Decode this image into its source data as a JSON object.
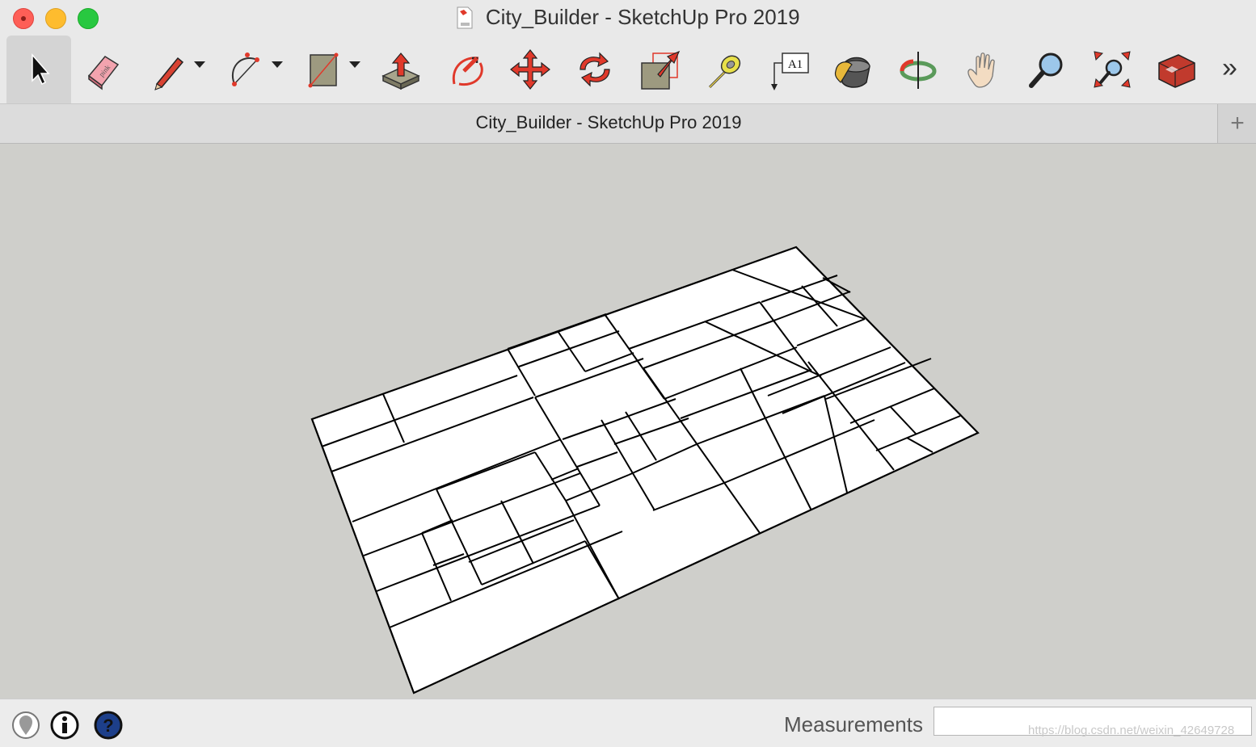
{
  "window": {
    "title": "City_Builder - SketchUp Pro 2019"
  },
  "toolbar": {
    "tools": [
      {
        "name": "select-tool",
        "label": "Select",
        "active": true
      },
      {
        "name": "eraser-tool",
        "label": "Eraser"
      },
      {
        "name": "pencil-tool",
        "label": "Line",
        "dropdown": true
      },
      {
        "name": "arc-tool",
        "label": "Arc",
        "dropdown": true
      },
      {
        "name": "rectangle-tool",
        "label": "Rectangle",
        "dropdown": true
      },
      {
        "name": "push-pull-tool",
        "label": "Push/Pull"
      },
      {
        "name": "offset-tool",
        "label": "Follow Me"
      },
      {
        "name": "move-tool",
        "label": "Move"
      },
      {
        "name": "rotate-tool",
        "label": "Rotate"
      },
      {
        "name": "scale-tool",
        "label": "Scale"
      },
      {
        "name": "tape-measure-tool",
        "label": "Tape Measure"
      },
      {
        "name": "text-tool",
        "label": "Text",
        "glyph": "A1"
      },
      {
        "name": "paint-bucket-tool",
        "label": "Paint Bucket"
      },
      {
        "name": "orbit-tool",
        "label": "Orbit"
      },
      {
        "name": "pan-tool",
        "label": "Pan"
      },
      {
        "name": "zoom-tool",
        "label": "Zoom"
      },
      {
        "name": "zoom-extents-tool",
        "label": "Zoom Extents"
      },
      {
        "name": "warehouse-tool",
        "label": "3D Warehouse"
      }
    ],
    "overflow": "»"
  },
  "tabs": {
    "title": "City_Builder - SketchUp Pro 2019",
    "add": "+"
  },
  "statusbar": {
    "measurements_label": "Measurements",
    "measurements_value": "",
    "watermark": "https://blog.csdn.net/weixin_42649728"
  },
  "colors": {
    "viewport_bg": "#cfcfcb",
    "plane_fill": "#ffffff",
    "edge": "#000000",
    "accent_red": "#e0392b"
  }
}
